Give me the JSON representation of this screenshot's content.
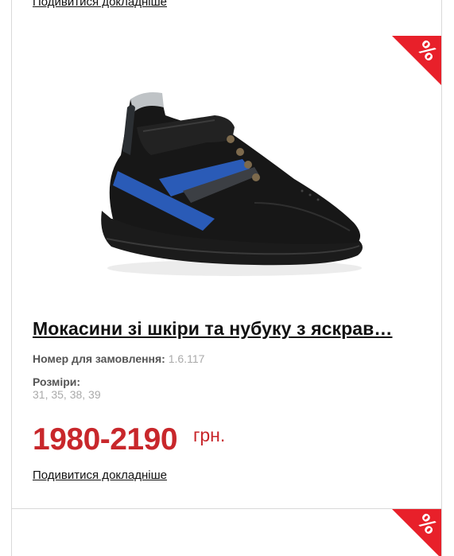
{
  "prev_card": {
    "details_link": "Подивитися докладніше"
  },
  "product": {
    "sale_badge": "%",
    "image_icon": "shoe-product-image",
    "title": "Мокасини зі шкіри та нубуку з яскрав…",
    "order_label": "Номер для замовлення:",
    "order_value": "1.6.117",
    "sizes_label": "Розміри:",
    "sizes_value": "31, 35, 38, 39",
    "price": "1980-2190",
    "currency": "грн.",
    "details_link": "Подивитися докладніше"
  },
  "next_card": {
    "sale_badge": "%"
  },
  "colors": {
    "accent_red": "#c8272b",
    "badge_red": "#e8202a"
  }
}
